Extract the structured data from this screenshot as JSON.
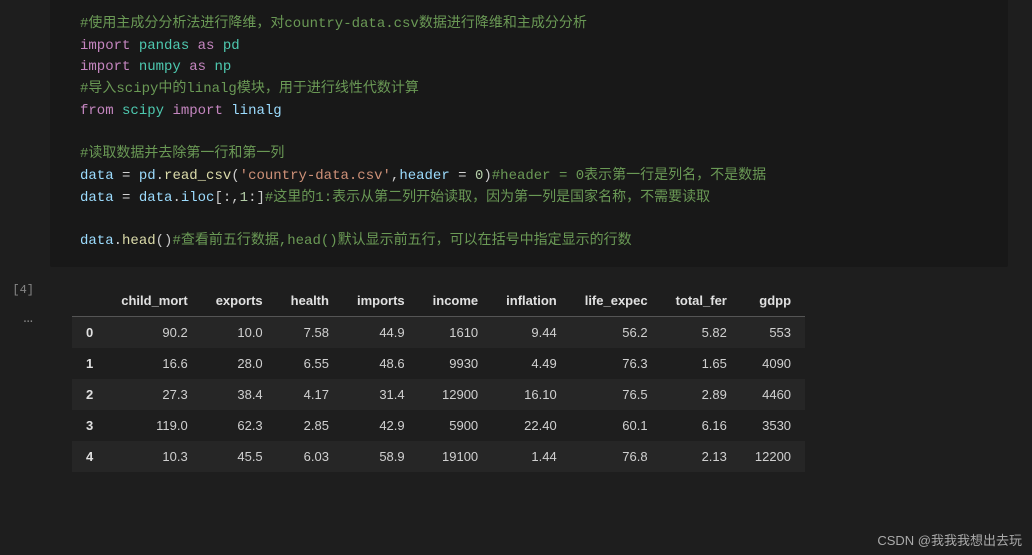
{
  "execution_count": "[4]",
  "ellipsis": "…",
  "code": {
    "l1": {
      "comment": "#使用主成分分析法进行降维，对country-data.csv数据进行降维和主成分分析"
    },
    "l2": {
      "kw1": "import",
      "mod": "pandas",
      "kw2": "as",
      "alias": "pd"
    },
    "l3": {
      "kw1": "import",
      "mod": "numpy",
      "kw2": "as",
      "alias": "np"
    },
    "l4": {
      "comment": "#导入scipy中的linalg模块，用于进行线性代数计算"
    },
    "l5": {
      "kw1": "from",
      "mod": "scipy",
      "kw2": "import",
      "name": "linalg"
    },
    "l6": {
      "blank": ""
    },
    "l7": {
      "comment": "#读取数据并去除第一行和第一列"
    },
    "l8": {
      "lhs": "data",
      "eq": "=",
      "obj": "pd",
      "dot": ".",
      "fn": "read_csv",
      "lp": "(",
      "str": "'country-data.csv'",
      "comma": ",",
      "arg": "header",
      "eq2": " = ",
      "num": "0",
      "rp": ")",
      "comment": "#header = 0表示第一行是列名，不是数据"
    },
    "l9": {
      "lhs": "data",
      "eq": "=",
      "rhs1": "data",
      "dot": ".",
      "attr": "iloc",
      "slice": "[:,",
      "num": "1",
      "slice2": ":]",
      "comment": "#这里的1:表示从第二列开始读取，因为第一列是国家名称，不需要读取"
    },
    "l10": {
      "blank": ""
    },
    "l11": {
      "obj": "data",
      "dot": ".",
      "fn": "head",
      "paren": "()",
      "comment": "#查看前五行数据,head()默认显示前五行，可以在括号中指定显示的行数"
    }
  },
  "table": {
    "columns": [
      "",
      "child_mort",
      "exports",
      "health",
      "imports",
      "income",
      "inflation",
      "life_expec",
      "total_fer",
      "gdpp"
    ],
    "rows": [
      [
        "0",
        "90.2",
        "10.0",
        "7.58",
        "44.9",
        "1610",
        "9.44",
        "56.2",
        "5.82",
        "553"
      ],
      [
        "1",
        "16.6",
        "28.0",
        "6.55",
        "48.6",
        "9930",
        "4.49",
        "76.3",
        "1.65",
        "4090"
      ],
      [
        "2",
        "27.3",
        "38.4",
        "4.17",
        "31.4",
        "12900",
        "16.10",
        "76.5",
        "2.89",
        "4460"
      ],
      [
        "3",
        "119.0",
        "62.3",
        "2.85",
        "42.9",
        "5900",
        "22.40",
        "60.1",
        "6.16",
        "3530"
      ],
      [
        "4",
        "10.3",
        "45.5",
        "6.03",
        "58.9",
        "19100",
        "1.44",
        "76.8",
        "2.13",
        "12200"
      ]
    ]
  },
  "watermark": "CSDN @我我我想出去玩"
}
